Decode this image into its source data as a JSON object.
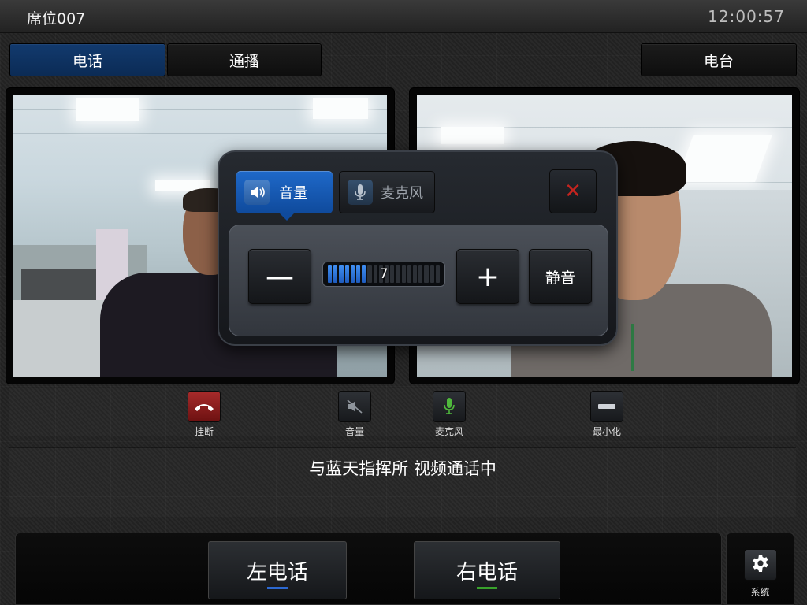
{
  "header": {
    "seat_title": "席位007",
    "clock": "12:00:57"
  },
  "tabs": [
    {
      "label": "电话",
      "active": true
    },
    {
      "label": "通播",
      "active": false
    },
    {
      "label": "电台",
      "active": false
    }
  ],
  "volume_popup": {
    "tab_volume": "音量",
    "tab_mic": "麦克风",
    "active_tab": "volume",
    "close_icon": "close-x-icon",
    "minus_label": "—",
    "plus_label": "+",
    "mute_label": "静音",
    "volume_value": "7",
    "volume_level": 7,
    "volume_max": 20
  },
  "controls": {
    "hangup_label": "挂断",
    "volume_label": "音量",
    "mic_label": "麦克风",
    "minimize_label": "最小化"
  },
  "status": {
    "text": "与蓝天指挥所 视频通话中"
  },
  "bottom": {
    "left_phone": "左电话",
    "right_phone": "右电话",
    "system_label": "系统"
  },
  "colors": {
    "accent_blue": "#1f69c9",
    "hangup_red": "#a82b2b",
    "mic_green": "#38a12b",
    "close_red": "#c5241f"
  }
}
